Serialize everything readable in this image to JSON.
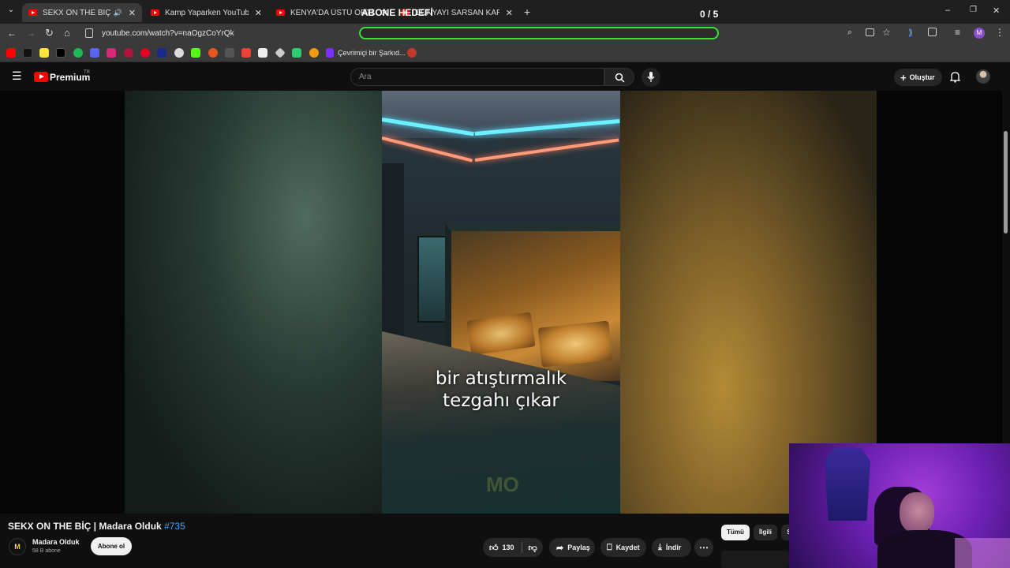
{
  "browser": {
    "tabs": [
      {
        "title": "SEKX ON THE BİÇ | Madara",
        "active": true
      },
      {
        "title": "Kamp Yaparken YouTuberların E",
        "active": false
      },
      {
        "title": "KENYA'DA ÜSTÜ ÖRTÜLEN KO",
        "active": false
      },
      {
        "title": "DÜNYAYI SARSAN KARANLIK A",
        "active": false
      }
    ],
    "overlay_title": "ABONE HEDEFİ",
    "overlay_counter": "0 / 5",
    "url": "youtube.com/watch?v=naOgzCoYrQk",
    "profile_initial": "M",
    "bookmark_label": "Çevrimiçi bir Şarkıd...",
    "accent_green": "#3fdc3f"
  },
  "youtube": {
    "logo_text": "Premium",
    "region": "TR",
    "search_placeholder": "Ara",
    "create_label": "Oluştur"
  },
  "video": {
    "subtitle_line1": "bir atıştırmalık",
    "subtitle_line2": "tezgahı çıkar",
    "watermark": "MO"
  },
  "meta": {
    "title": "SEKX ON THE BİÇ | Madara Olduk",
    "hashtag": "#735",
    "channel_name": "Madara Olduk",
    "subscribers": "58 B abone",
    "subscribe_label": "Abone ol",
    "likes": "130",
    "share_label": "Paylaş",
    "save_label": "Kaydet",
    "download_label": "İndir",
    "chips": [
      "Tümü",
      "İlgili",
      "S"
    ]
  }
}
